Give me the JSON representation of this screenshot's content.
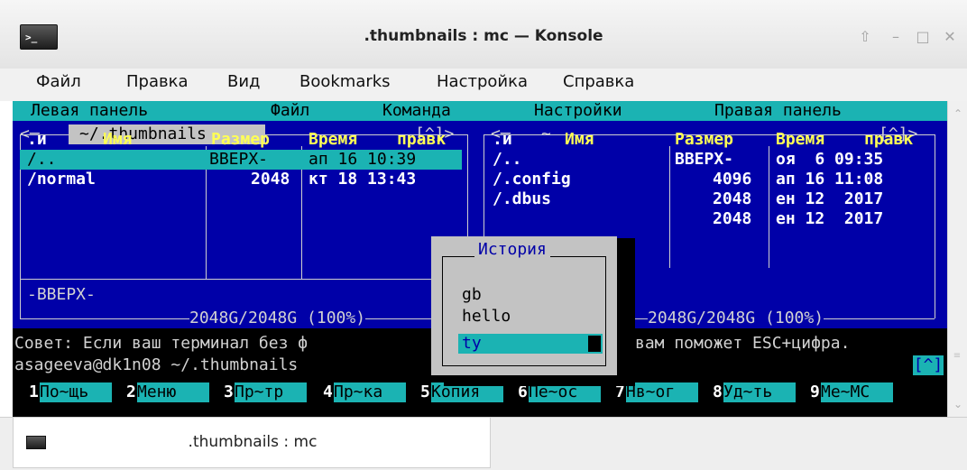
{
  "window": {
    "title": ".thumbnails : mc — Konsole",
    "icon": "terminal-icon",
    "controls": [
      "keep-above-icon",
      "minimize-icon",
      "maximize-icon",
      "close-icon"
    ]
  },
  "menubar": [
    "Файл",
    "Правка",
    "Вид",
    "Bookmarks",
    "Настройка",
    "Справка"
  ],
  "mc_menu": {
    "left_panel": "Левая панель",
    "file": "Файл",
    "command": "Команда",
    "settings": "Настройки",
    "right_panel": "Правая панель"
  },
  "left_panel": {
    "path": "~/.thumbnails",
    "top_left_marker": "<─",
    "top_right_marker": "[^]>",
    "headers": {
      "sort": ".и",
      "name": "Имя",
      "size": "Размер",
      "time": "Время",
      "modify": "правк"
    },
    "rows": [
      {
        "name": "/..",
        "size": "ВВЕРХ-",
        "time": "ап 16 10:39"
      },
      {
        "name": "/normal",
        "size": "2048",
        "time": "кт 18 13:43"
      }
    ],
    "mini_status": "-ВВЕРХ-",
    "free_space": "2048G/2048G (100%)"
  },
  "right_panel": {
    "path": "~",
    "top_left_marker": "<─",
    "top_right_marker": "[^]>",
    "headers": {
      "sort": ".и",
      "name": "Имя",
      "size": "Размер",
      "time": "Время",
      "modify": "правк"
    },
    "rows": [
      {
        "name": "/..",
        "size": "ВВЕРХ-",
        "time": "оя  6 09:35"
      },
      {
        "name": "/.config",
        "size": "4096",
        "time": "ап 16 11:08"
      },
      {
        "name": "/.dbus",
        "size": "2048",
        "time": "ен 12  2017"
      },
      {
        "name": "",
        "size": "2048",
        "time": "ен 12  2017"
      }
    ],
    "free_space": "2048G/2048G (100%)"
  },
  "hint_left": "Совет: Если ваш терминал без ф",
  "hint_right": "вам поможет ESC+цифра.",
  "prompt": "asageeva@dk1n08 ~/.thumbnails",
  "prompt_corner": "[^]",
  "history": {
    "title": "История",
    "items": [
      "gb",
      "hello",
      "ty"
    ],
    "selected": "ty"
  },
  "fkeys": [
    {
      "num": "1",
      "label": "По~щь"
    },
    {
      "num": "2",
      "label": "Меню"
    },
    {
      "num": "3",
      "label": "Пр~тр"
    },
    {
      "num": "4",
      "label": "Пр~ка"
    },
    {
      "num": "5",
      "label": "Копия"
    },
    {
      "num": "6",
      "label": "Пе~ос"
    },
    {
      "num": "7",
      "label": "Нв~ог"
    },
    {
      "num": "8",
      "label": "Уд~ть"
    },
    {
      "num": "9",
      "label": "Ме~МС"
    }
  ],
  "tabs": [
    {
      "label": ".thumbnails : mc",
      "icon": "terminal-icon"
    }
  ]
}
